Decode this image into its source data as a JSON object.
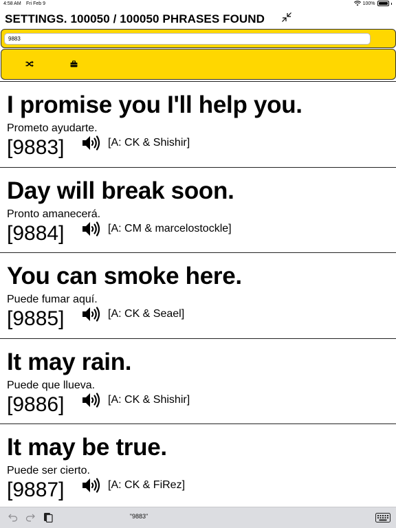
{
  "status_bar": {
    "time": "4:58 AM",
    "date": "Fri Feb 9",
    "battery": "100%"
  },
  "header": {
    "title": "SETTINGS. 100050 / 100050 PHRASES FOUND"
  },
  "search": {
    "value": "9883"
  },
  "toolbar": {
    "icons": [
      "shuffle-icon",
      "briefcase-icon"
    ]
  },
  "phrases": [
    {
      "english": "I promise you I'll help you.",
      "spanish": "Prometo ayudarte.",
      "number": "[9883]",
      "attribution": "[A: CK & Shishir]"
    },
    {
      "english": "Day will break soon.",
      "spanish": "Pronto amanecerá.",
      "number": "[9884]",
      "attribution": "[A: CM & marcelostockle]"
    },
    {
      "english": "You can smoke here.",
      "spanish": "Puede fumar aquí.",
      "number": "[9885]",
      "attribution": "[A: CK & Seael]"
    },
    {
      "english": "It may rain.",
      "spanish": "Puede que llueva.",
      "number": "[9886]",
      "attribution": "[A: CK & Shishir]"
    },
    {
      "english": "It may be true.",
      "spanish": "Puede ser cierto.",
      "number": "[9887]",
      "attribution": "[A: CK & FiRez]"
    }
  ],
  "keyboard_bar": {
    "suggestion": "\"9883\""
  },
  "colors": {
    "accent": "#ffd700",
    "keyboard_bar": "#dcdde1"
  }
}
